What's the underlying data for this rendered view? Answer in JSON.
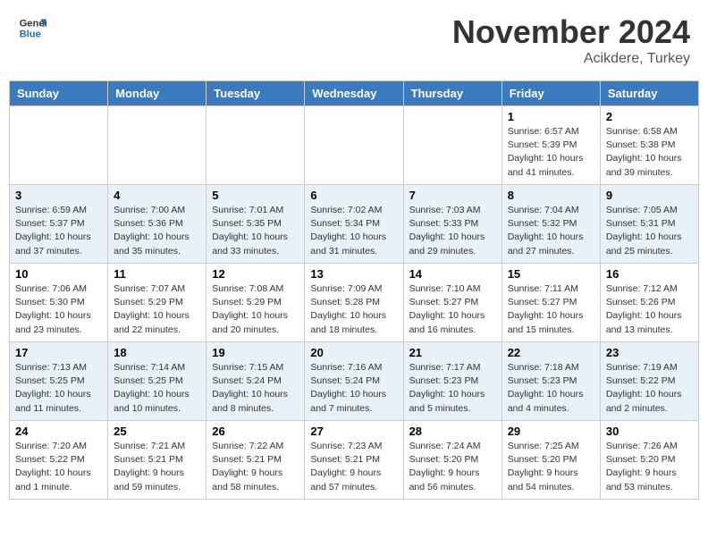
{
  "header": {
    "logo_line1": "General",
    "logo_line2": "Blue",
    "month_title": "November 2024",
    "location": "Acikdere, Turkey"
  },
  "weekdays": [
    "Sunday",
    "Monday",
    "Tuesday",
    "Wednesday",
    "Thursday",
    "Friday",
    "Saturday"
  ],
  "weeks": [
    [
      {
        "day": "",
        "info": ""
      },
      {
        "day": "",
        "info": ""
      },
      {
        "day": "",
        "info": ""
      },
      {
        "day": "",
        "info": ""
      },
      {
        "day": "",
        "info": ""
      },
      {
        "day": "1",
        "info": "Sunrise: 6:57 AM\nSunset: 5:39 PM\nDaylight: 10 hours\nand 41 minutes."
      },
      {
        "day": "2",
        "info": "Sunrise: 6:58 AM\nSunset: 5:38 PM\nDaylight: 10 hours\nand 39 minutes."
      }
    ],
    [
      {
        "day": "3",
        "info": "Sunrise: 6:59 AM\nSunset: 5:37 PM\nDaylight: 10 hours\nand 37 minutes."
      },
      {
        "day": "4",
        "info": "Sunrise: 7:00 AM\nSunset: 5:36 PM\nDaylight: 10 hours\nand 35 minutes."
      },
      {
        "day": "5",
        "info": "Sunrise: 7:01 AM\nSunset: 5:35 PM\nDaylight: 10 hours\nand 33 minutes."
      },
      {
        "day": "6",
        "info": "Sunrise: 7:02 AM\nSunset: 5:34 PM\nDaylight: 10 hours\nand 31 minutes."
      },
      {
        "day": "7",
        "info": "Sunrise: 7:03 AM\nSunset: 5:33 PM\nDaylight: 10 hours\nand 29 minutes."
      },
      {
        "day": "8",
        "info": "Sunrise: 7:04 AM\nSunset: 5:32 PM\nDaylight: 10 hours\nand 27 minutes."
      },
      {
        "day": "9",
        "info": "Sunrise: 7:05 AM\nSunset: 5:31 PM\nDaylight: 10 hours\nand 25 minutes."
      }
    ],
    [
      {
        "day": "10",
        "info": "Sunrise: 7:06 AM\nSunset: 5:30 PM\nDaylight: 10 hours\nand 23 minutes."
      },
      {
        "day": "11",
        "info": "Sunrise: 7:07 AM\nSunset: 5:29 PM\nDaylight: 10 hours\nand 22 minutes."
      },
      {
        "day": "12",
        "info": "Sunrise: 7:08 AM\nSunset: 5:29 PM\nDaylight: 10 hours\nand 20 minutes."
      },
      {
        "day": "13",
        "info": "Sunrise: 7:09 AM\nSunset: 5:28 PM\nDaylight: 10 hours\nand 18 minutes."
      },
      {
        "day": "14",
        "info": "Sunrise: 7:10 AM\nSunset: 5:27 PM\nDaylight: 10 hours\nand 16 minutes."
      },
      {
        "day": "15",
        "info": "Sunrise: 7:11 AM\nSunset: 5:27 PM\nDaylight: 10 hours\nand 15 minutes."
      },
      {
        "day": "16",
        "info": "Sunrise: 7:12 AM\nSunset: 5:26 PM\nDaylight: 10 hours\nand 13 minutes."
      }
    ],
    [
      {
        "day": "17",
        "info": "Sunrise: 7:13 AM\nSunset: 5:25 PM\nDaylight: 10 hours\nand 11 minutes."
      },
      {
        "day": "18",
        "info": "Sunrise: 7:14 AM\nSunset: 5:25 PM\nDaylight: 10 hours\nand 10 minutes."
      },
      {
        "day": "19",
        "info": "Sunrise: 7:15 AM\nSunset: 5:24 PM\nDaylight: 10 hours\nand 8 minutes."
      },
      {
        "day": "20",
        "info": "Sunrise: 7:16 AM\nSunset: 5:24 PM\nDaylight: 10 hours\nand 7 minutes."
      },
      {
        "day": "21",
        "info": "Sunrise: 7:17 AM\nSunset: 5:23 PM\nDaylight: 10 hours\nand 5 minutes."
      },
      {
        "day": "22",
        "info": "Sunrise: 7:18 AM\nSunset: 5:23 PM\nDaylight: 10 hours\nand 4 minutes."
      },
      {
        "day": "23",
        "info": "Sunrise: 7:19 AM\nSunset: 5:22 PM\nDaylight: 10 hours\nand 2 minutes."
      }
    ],
    [
      {
        "day": "24",
        "info": "Sunrise: 7:20 AM\nSunset: 5:22 PM\nDaylight: 10 hours\nand 1 minute."
      },
      {
        "day": "25",
        "info": "Sunrise: 7:21 AM\nSunset: 5:21 PM\nDaylight: 9 hours\nand 59 minutes."
      },
      {
        "day": "26",
        "info": "Sunrise: 7:22 AM\nSunset: 5:21 PM\nDaylight: 9 hours\nand 58 minutes."
      },
      {
        "day": "27",
        "info": "Sunrise: 7:23 AM\nSunset: 5:21 PM\nDaylight: 9 hours\nand 57 minutes."
      },
      {
        "day": "28",
        "info": "Sunrise: 7:24 AM\nSunset: 5:20 PM\nDaylight: 9 hours\nand 56 minutes."
      },
      {
        "day": "29",
        "info": "Sunrise: 7:25 AM\nSunset: 5:20 PM\nDaylight: 9 hours\nand 54 minutes."
      },
      {
        "day": "30",
        "info": "Sunrise: 7:26 AM\nSunset: 5:20 PM\nDaylight: 9 hours\nand 53 minutes."
      }
    ]
  ]
}
